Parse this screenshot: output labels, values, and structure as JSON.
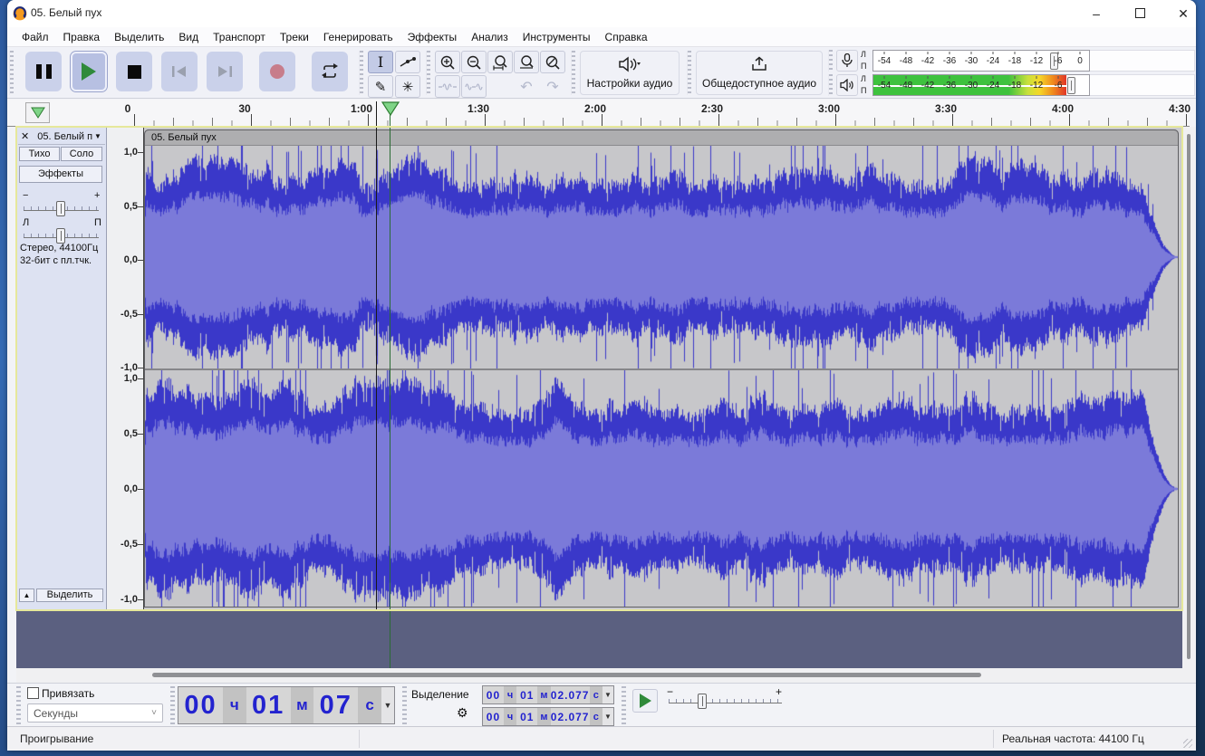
{
  "window": {
    "title": "05. Белый пух"
  },
  "titlebar": {
    "minimize_icon": "–",
    "close_icon": "✕"
  },
  "menu": {
    "items": [
      "Файл",
      "Правка",
      "Выделить",
      "Вид",
      "Транспорт",
      "Треки",
      "Генерировать",
      "Эффекты",
      "Анализ",
      "Инструменты",
      "Справка"
    ]
  },
  "toolbar": {
    "audio_setup_label": "Настройки аудио",
    "share_audio_label": "Общедоступное аудио"
  },
  "meters": {
    "left_label": "Л",
    "right_label": "П",
    "record_scale": [
      "-54",
      "-48",
      "-42",
      "-36",
      "-30",
      "-24",
      "-18",
      "-12",
      "-6",
      "0"
    ],
    "playback_scale": [
      "-54",
      "-48",
      "-42",
      "-36",
      "-30",
      "-24",
      "-18",
      "-12",
      "-6"
    ],
    "playback_level_db": -3,
    "record_thumb_db": -10,
    "playback_thumb_db": -1
  },
  "timeline": {
    "labels": [
      "0",
      "30",
      "1:00",
      "1:30",
      "2:00",
      "2:30",
      "3:00",
      "3:30",
      "4:00",
      "4:30"
    ]
  },
  "track": {
    "close_icon": "✕",
    "name": "05. Белый п",
    "dropdown_icon": "▼",
    "mute_label": "Тихо",
    "solo_label": "Соло",
    "effects_label": "Эффекты",
    "gain_minus": "−",
    "gain_plus": "+",
    "pan_left": "Л",
    "pan_right": "П",
    "info_line1": "Стерео, 44100Гц",
    "info_line2": "32-бит с пл.тчк.",
    "collapse_icon": "▲",
    "select_label": "Выделить",
    "clip_title": "05. Белый пух",
    "amp_labels": [
      "1,0",
      "0,5",
      "0,0",
      "-0,5",
      "-1,0"
    ]
  },
  "selection_bar": {
    "snap_label": "Привязать",
    "format_value": "Секунды",
    "selection_label": "Выделение",
    "gear_icon": "⚙",
    "big_time": [
      "00",
      "ч",
      "01",
      "м",
      "07",
      "с"
    ],
    "sel_start": [
      "00",
      "ч",
      "01",
      "м",
      "02.077",
      "с"
    ],
    "sel_end": [
      "00",
      "ч",
      "01",
      "м",
      "02.077",
      "с"
    ]
  },
  "status": {
    "left": "Проигрывание",
    "right": "Реальная частота: 44100 Гц"
  },
  "playback": {
    "cursor_time": "1:07",
    "selection_time": "1:02.077"
  },
  "colors": {
    "wave_dark": "#3a38c9",
    "wave_light": "#7b7ad9",
    "clip_bg": "#c7c7ca",
    "play_green": "#2f8a3a",
    "record_red": "#c77d8b",
    "cursor_green": "#2a6b33",
    "focus_border": "#e6e89b",
    "meter_green": "#3ec23e",
    "meter_red": "#e03528"
  }
}
